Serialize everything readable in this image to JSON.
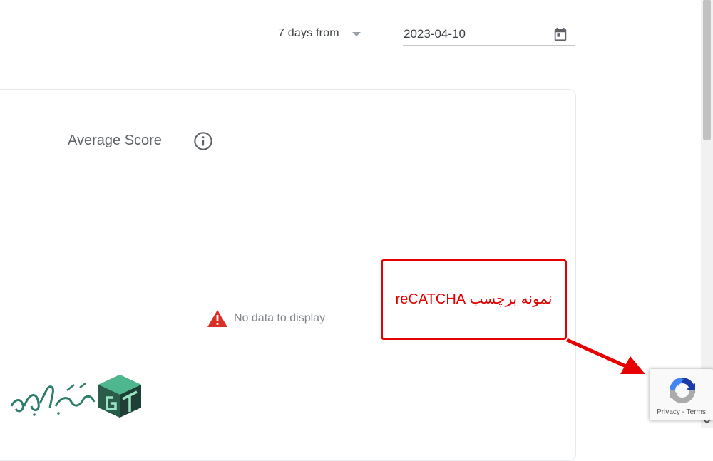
{
  "header": {
    "range_label": "7 days from",
    "date_value": "2023-04-10"
  },
  "card": {
    "title": "Average Score",
    "empty_message": "No data to display"
  },
  "annotation": {
    "label": "نمونه برچسب reCATCHA"
  },
  "recaptcha": {
    "privacy_label": "Privacy",
    "separator": " - ",
    "terms_label": "Terms"
  },
  "colors": {
    "annotation_red": "#e60000",
    "warning_red": "#d93025",
    "recaptcha_blue": "#1c3aa9",
    "recaptcha_light_blue": "#4285f4",
    "recaptcha_gray": "#ababab",
    "logo_green": "#2e7d6b"
  },
  "icons": [
    "chevron-down-icon",
    "calendar-icon",
    "info-icon",
    "warning-icon",
    "recaptcha-logo-icon",
    "watermark-logo"
  ]
}
